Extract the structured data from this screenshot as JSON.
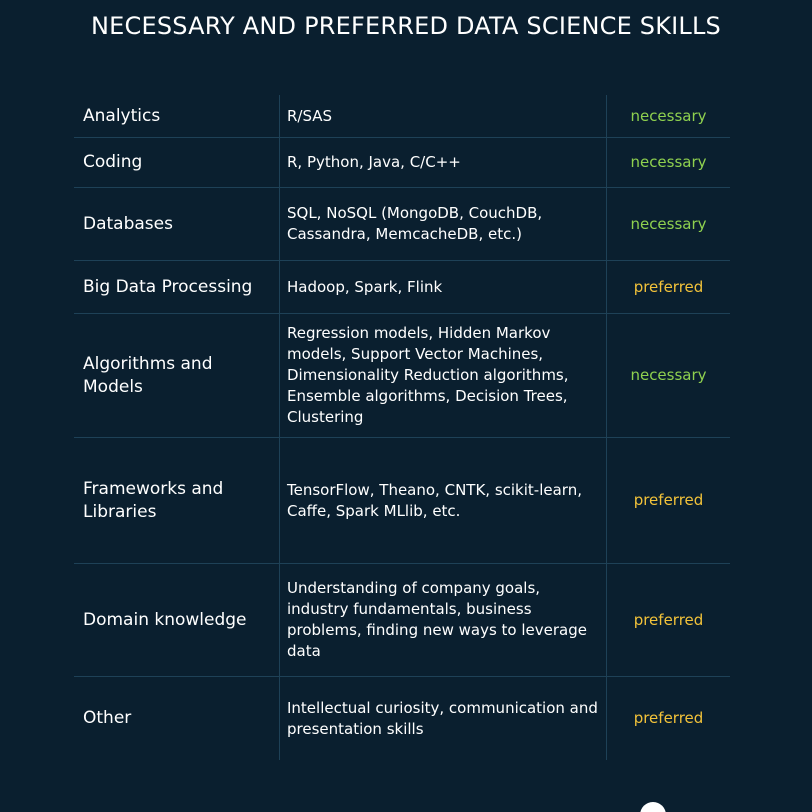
{
  "title": "NECESSARY AND PREFERRED DATA SCIENCE SKILLS",
  "colors": {
    "background": "#0a1f2f",
    "divider": "#1e4157",
    "necessary": "#8fd14f",
    "preferred": "#f2c23a"
  },
  "rows": [
    {
      "skill": "Analytics",
      "tools": "R/SAS",
      "level": "necessary"
    },
    {
      "skill": "Coding",
      "tools": "R, Python, Java, C/C++",
      "level": "necessary"
    },
    {
      "skill": "Databases",
      "tools": "SQL, NoSQL (MongoDB, CouchDB, Cassandra, MemcacheDB, etc.)",
      "level": "necessary"
    },
    {
      "skill": "Big Data Processing",
      "tools": "Hadoop, Spark, Flink",
      "level": "preferred"
    },
    {
      "skill": "Algorithms and Models",
      "tools": "Regression models, Hidden Markov models, Support Vector Machines, Dimensionality Reduction algorithms, Ensemble algorithms, Decision Trees, Clustering",
      "level": "necessary"
    },
    {
      "skill": "Frameworks and Libraries",
      "tools": "TensorFlow, Theano, CNTK, scikit-learn, Caffe, Spark MLlib, etc.",
      "level": "preferred"
    },
    {
      "skill": "Domain knowledge",
      "tools": "Understanding of company goals, industry fundamentals, business problems, finding new ways to leverage data",
      "level": "preferred"
    },
    {
      "skill": "Other",
      "tools": "Intellectual curiosity, communication and presentation skills",
      "level": "preferred"
    }
  ]
}
